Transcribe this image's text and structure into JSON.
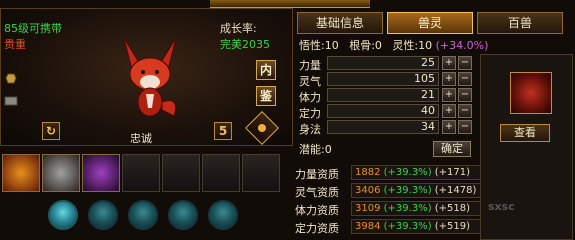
{
  "pet": {
    "carry_level": "85级可携带",
    "rarity": "贵重",
    "growth_label": "成长率:",
    "growth_value": "完美2035",
    "name": "忠诚",
    "btn_inner": "内",
    "btn_appraise": "鉴",
    "btn_prev": "↻",
    "btn_next": "5"
  },
  "tabs": [
    {
      "label": "基础信息",
      "active": false
    },
    {
      "label": "兽灵",
      "active": true
    },
    {
      "label": "百兽",
      "active": false
    }
  ],
  "header": {
    "wuxing_label": "悟性:10",
    "gengu_label": "根骨:0",
    "lingxing_label": "灵性:10",
    "lingxing_plus": "(+34.0%)"
  },
  "stats": [
    {
      "label": "力量",
      "value": "25"
    },
    {
      "label": "灵气",
      "value": "105"
    },
    {
      "label": "体力",
      "value": "21"
    },
    {
      "label": "定力",
      "value": "40"
    },
    {
      "label": "身法",
      "value": "34"
    }
  ],
  "potential": {
    "label": "潜能:0",
    "confirm": "确定"
  },
  "aptitudes": [
    {
      "label": "力量资质",
      "base": "1882",
      "bonus": "(+39.3%)",
      "sub": "(+171)"
    },
    {
      "label": "灵气资质",
      "base": "3406",
      "bonus": "(+39.3%)",
      "sub": "(+1478)"
    },
    {
      "label": "体力资质",
      "base": "3109",
      "bonus": "(+39.3%)",
      "sub": "(+518)"
    },
    {
      "label": "定力资质",
      "base": "3984",
      "bonus": "(+39.3%)",
      "sub": "(+519)"
    }
  ],
  "right": {
    "view_btn": "查看",
    "watermark": "sxsc"
  }
}
